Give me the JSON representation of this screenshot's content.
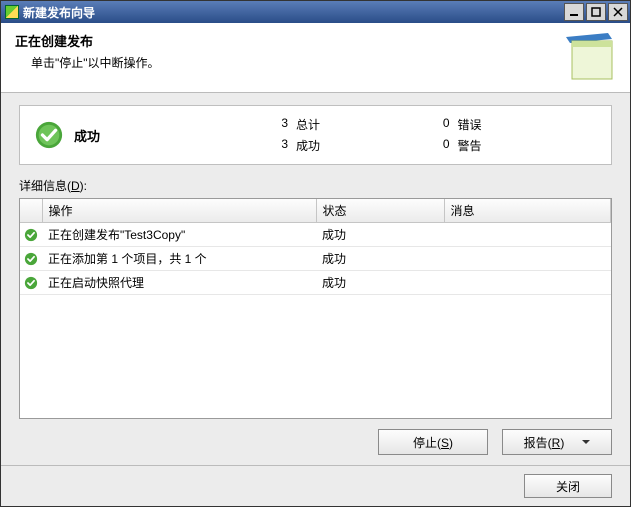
{
  "titlebar": {
    "title": "新建发布向导"
  },
  "header": {
    "title": "正在创建发布",
    "subtitle": "单击\"停止\"以中断操作。"
  },
  "summary": {
    "label": "成功",
    "stats": {
      "total": {
        "n": "3",
        "label": "总计"
      },
      "error": {
        "n": "0",
        "label": "错误"
      },
      "success": {
        "n": "3",
        "label": "成功"
      },
      "warn": {
        "n": "0",
        "label": "警告"
      }
    }
  },
  "detail": {
    "label_pre": "详细信息(",
    "label_ak": "D",
    "label_post": "):",
    "cols": {
      "icon": "",
      "op": "操作",
      "status": "状态",
      "msg": "消息"
    },
    "rows": [
      {
        "op": "正在创建发布\"Test3Copy\"",
        "status": "成功",
        "msg": ""
      },
      {
        "op": "正在添加第 1 个项目，共 1 个",
        "status": "成功",
        "msg": ""
      },
      {
        "op": "正在启动快照代理",
        "status": "成功",
        "msg": ""
      }
    ]
  },
  "buttons": {
    "stop_pre": "停止(",
    "stop_ak": "S",
    "stop_post": ")",
    "report_pre": "报告(",
    "report_ak": "R",
    "report_post": ")",
    "close": "关闭"
  }
}
